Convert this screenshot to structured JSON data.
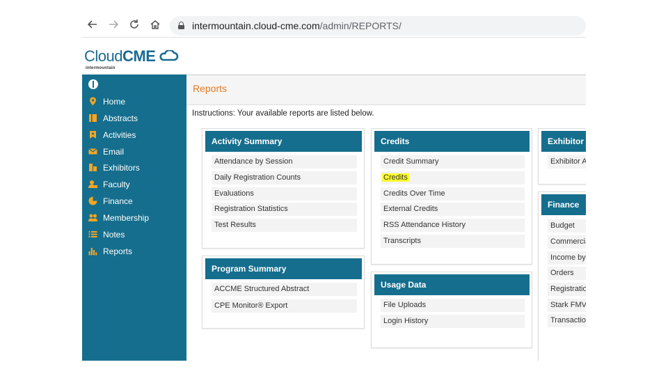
{
  "browser": {
    "url_host": "intermountain.cloud-cme.com",
    "url_path": "/admin/REPORTS/"
  },
  "logo": {
    "text_light": "Cloud",
    "text_bold": "CME",
    "subtitle": "intermountain"
  },
  "sidebar": {
    "items": [
      {
        "label": "Home",
        "icon": "map-pin-icon"
      },
      {
        "label": "Abstracts",
        "icon": "book-icon"
      },
      {
        "label": "Activities",
        "icon": "bookmark-icon"
      },
      {
        "label": "Email",
        "icon": "envelope-icon"
      },
      {
        "label": "Exhibitors",
        "icon": "blocks-icon"
      },
      {
        "label": "Faculty",
        "icon": "user-icon"
      },
      {
        "label": "Finance",
        "icon": "pie-chart-icon"
      },
      {
        "label": "Membership",
        "icon": "users-icon"
      },
      {
        "label": "Notes",
        "icon": "list-icon"
      },
      {
        "label": "Reports",
        "icon": "bar-chart-icon"
      }
    ]
  },
  "main": {
    "title": "Reports",
    "instructions": "Instructions: Your available reports are listed below."
  },
  "panels": {
    "activity_summary": {
      "title": "Activity Summary",
      "items": [
        "Attendance by Session",
        "Daily Registration Counts",
        "Evaluations",
        "Registration Statistics",
        "Test Results"
      ]
    },
    "program_summary": {
      "title": "Program Summary",
      "items": [
        "ACCME Structured Abstract",
        "CPE Monitor® Export"
      ]
    },
    "credits": {
      "title": "Credits",
      "items": [
        "Credit Summary",
        "Credits",
        "Credits Over Time",
        "External Credits",
        "RSS Attendance History",
        "Transcripts"
      ],
      "highlighted": "Credits"
    },
    "usage_data": {
      "title": "Usage Data",
      "items": [
        "File Uploads",
        "Login History"
      ]
    },
    "exhibitor": {
      "title": "Exhibitor",
      "items": [
        "Exhibitor A"
      ]
    },
    "finance": {
      "title": "Finance",
      "items": [
        "Budget",
        "Commercia",
        "Income by",
        "Orders",
        "Registratio",
        "Stark FMV",
        "Transaction"
      ]
    }
  },
  "colors": {
    "brand": "#156e8d",
    "accent": "#e8781a",
    "icon": "#f5a623",
    "highlight": "#fdfd2a"
  }
}
